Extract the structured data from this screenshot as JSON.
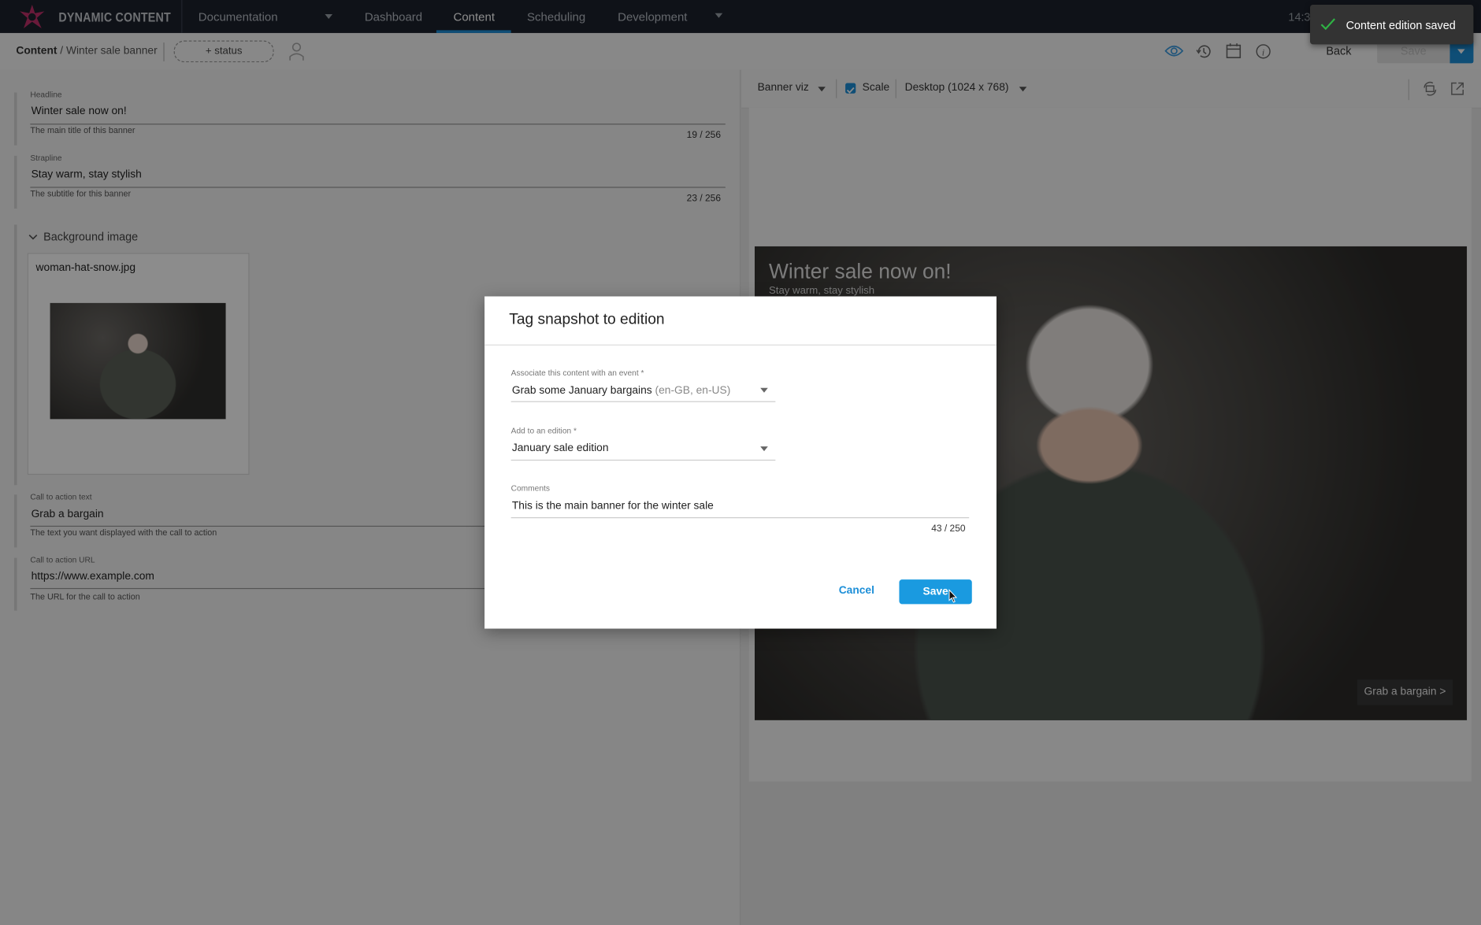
{
  "app": {
    "brand": "DYNAMIC CONTENT",
    "time": "14:3"
  },
  "nav": {
    "hub": "Documentation",
    "items": [
      {
        "label": "Dashboard"
      },
      {
        "label": "Content",
        "active": true
      },
      {
        "label": "Scheduling"
      },
      {
        "label": "Development"
      }
    ]
  },
  "breadcrumb": {
    "root": "Content",
    "current": "/ Winter sale banner"
  },
  "status_button": "+ status",
  "actions": {
    "back": "Back",
    "save": "Save"
  },
  "form": {
    "headline": {
      "label": "Headline",
      "value": "Winter sale now on!",
      "help": "The main title of this banner",
      "count": "19 / 256"
    },
    "strapline": {
      "label": "Strapline",
      "value": "Stay warm, stay stylish",
      "help": "The subtitle for this banner",
      "count": "23 / 256"
    },
    "background": {
      "label": "Background image",
      "filename": "woman-hat-snow.jpg"
    },
    "cta_text": {
      "label": "Call to action text",
      "value": "Grab a bargain",
      "help": "The text you want displayed with the call to action"
    },
    "cta_url": {
      "label": "Call to action URL",
      "value": "https://www.example.com",
      "help": "The URL for the call to action"
    }
  },
  "preview": {
    "viz": "Banner viz",
    "scale_label": "Scale",
    "scale_checked": true,
    "device": "Desktop (1024 x 768)",
    "banner": {
      "headline": "Winter sale now on!",
      "strapline": "Stay warm, stay stylish",
      "cta": "Grab a bargain >"
    }
  },
  "dialog": {
    "title": "Tag snapshot to edition",
    "event_label": "Associate this content with an event *",
    "event_value": "Grab some January bargains",
    "event_locales": "(en-GB, en-US)",
    "edition_label": "Add to an edition *",
    "edition_value": "January sale edition",
    "comments_label": "Comments",
    "comments_value": "This is the main banner for the winter sale",
    "comments_count": "43 / 250",
    "cancel": "Cancel",
    "save": "Save"
  },
  "toast": {
    "message": "Content edition saved"
  },
  "colors": {
    "accent": "#1d8fd8",
    "topbar": "#1c222c",
    "success": "#2fb344"
  }
}
